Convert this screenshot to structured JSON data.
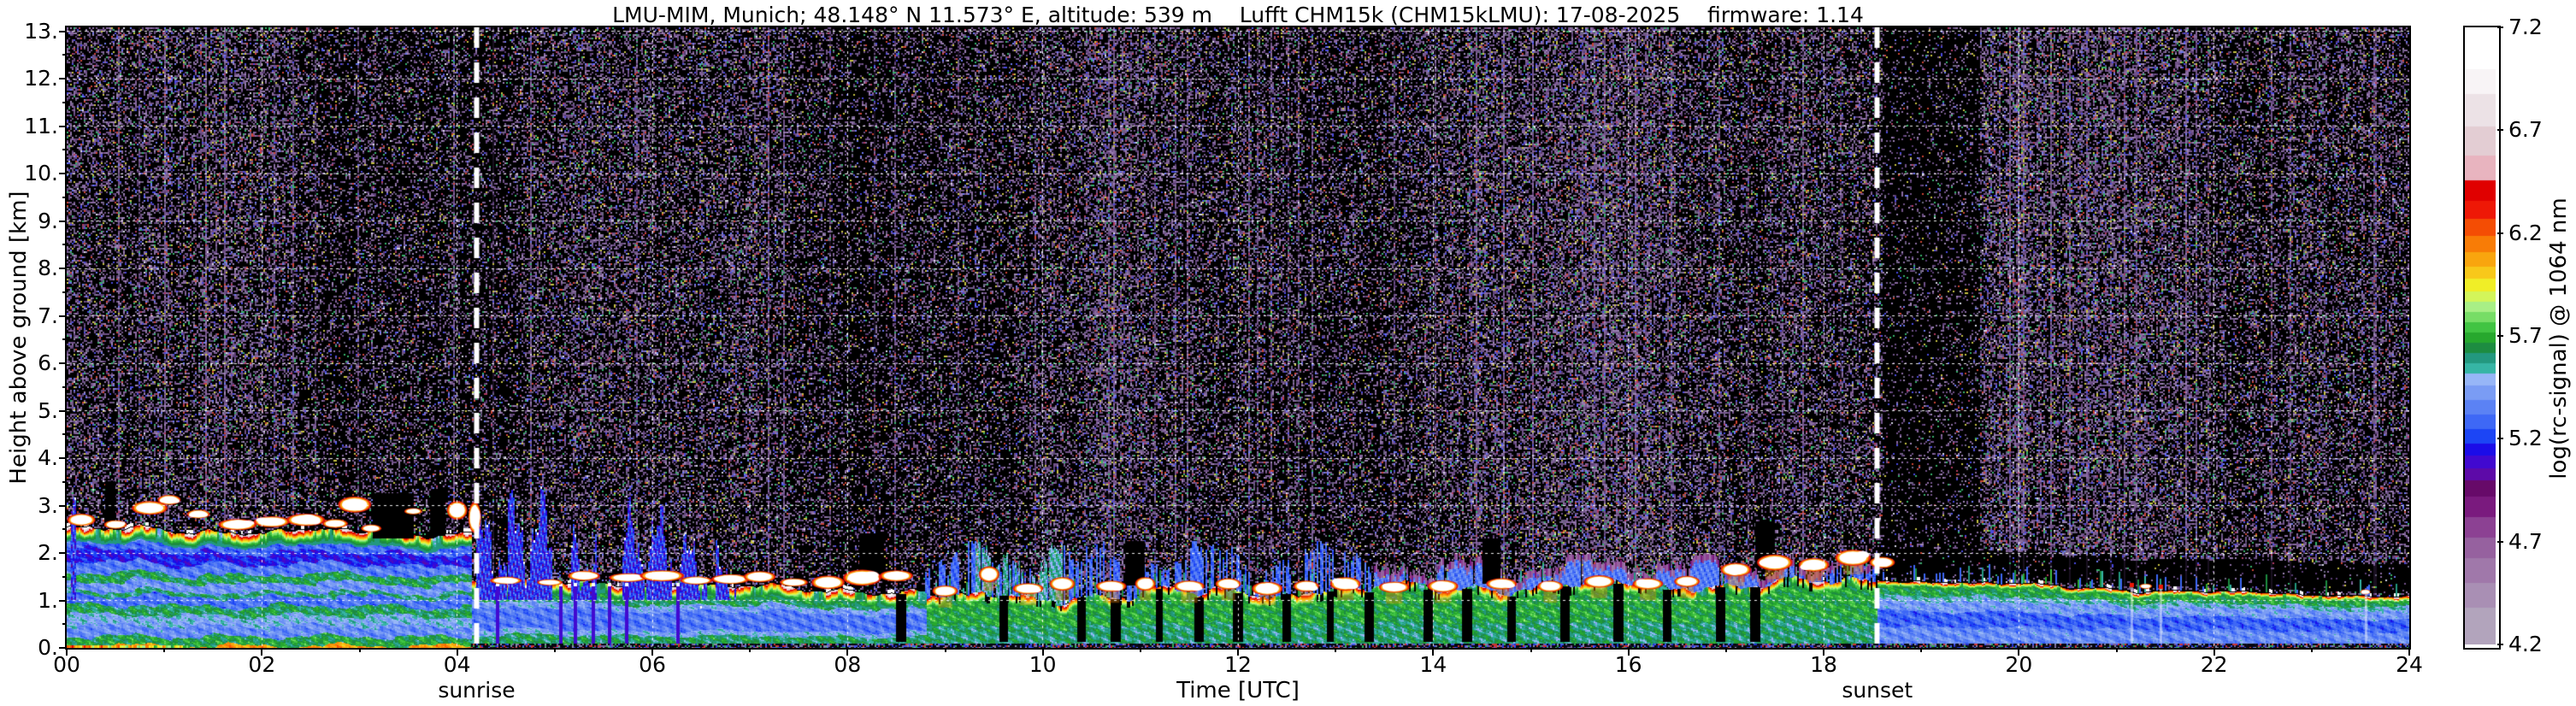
{
  "figure": {
    "title": "LMU-MIM, Munich; 48.148° N 11.573° E, altitude: 539 m    Lufft CHM15k (CHM15kLMU): 17-08-2025    firmware: 1.14",
    "xlabel": "Time [UTC]",
    "ylabel": "Height above ground [km]",
    "colorbar_label": "log(rc-signal) @ 1064 nm"
  },
  "axes": {
    "x": {
      "min": 0,
      "max": 24,
      "minor_step": 1,
      "ticks": [
        {
          "v": 0,
          "label": "00"
        },
        {
          "v": 2,
          "label": "02"
        },
        {
          "v": 4,
          "label": "04"
        },
        {
          "v": 6,
          "label": "06"
        },
        {
          "v": 8,
          "label": "08"
        },
        {
          "v": 10,
          "label": "10"
        },
        {
          "v": 12,
          "label": "12"
        },
        {
          "v": 14,
          "label": "14"
        },
        {
          "v": 16,
          "label": "16"
        },
        {
          "v": 18,
          "label": "18"
        },
        {
          "v": 20,
          "label": "20"
        },
        {
          "v": 22,
          "label": "22"
        },
        {
          "v": 24,
          "label": "24"
        }
      ]
    },
    "y": {
      "min": 0,
      "max": 13.08,
      "minor_step": 0.5,
      "ticks": [
        {
          "v": 0,
          "label": "0."
        },
        {
          "v": 1,
          "label": "1."
        },
        {
          "v": 2,
          "label": "2."
        },
        {
          "v": 3,
          "label": "3."
        },
        {
          "v": 4,
          "label": "4."
        },
        {
          "v": 5,
          "label": "5."
        },
        {
          "v": 6,
          "label": "6."
        },
        {
          "v": 7,
          "label": "7."
        },
        {
          "v": 8,
          "label": "8."
        },
        {
          "v": 9,
          "label": "9."
        },
        {
          "v": 10,
          "label": "10."
        },
        {
          "v": 11,
          "label": "11."
        },
        {
          "v": 12,
          "label": "12."
        },
        {
          "v": 13,
          "label": "13."
        }
      ]
    }
  },
  "colorbar": {
    "min": 4.2,
    "max": 7.2,
    "ticks": [
      {
        "v": 7.2,
        "label": "7.2"
      },
      {
        "v": 6.7,
        "label": "6.7"
      },
      {
        "v": 6.2,
        "label": "6.2"
      },
      {
        "v": 5.7,
        "label": "5.7"
      },
      {
        "v": 5.2,
        "label": "5.2"
      },
      {
        "v": 4.7,
        "label": "4.7"
      },
      {
        "v": 4.2,
        "label": "4.2"
      }
    ]
  },
  "annotations": {
    "sunrise": {
      "label": "sunrise",
      "t": 4.2
    },
    "sunset": {
      "label": "sunset",
      "t": 18.55
    }
  },
  "chart_data": {
    "type": "heatmap",
    "title": "LMU-MIM, Munich; 48.148° N 11.573° E, altitude: 539 m  Lufft CHM15k (CHM15kLMU): 17-08-2025  firmware: 1.14",
    "xlabel": "Time [UTC]",
    "ylabel": "Height above ground [km]",
    "value_label": "log(rc-signal) @ 1064 nm",
    "x_range_hours": [
      0,
      24
    ],
    "y_range_km": [
      0,
      13.08
    ],
    "value_range": [
      4.2,
      7.2
    ],
    "grid": {
      "color": "#ffffff",
      "style": "dashed",
      "x_step_h": 2,
      "y_step_km": 1
    },
    "sunrise_t": 4.2,
    "sunset_t": 18.55,
    "colormap": [
      [
        4.2,
        "#b2a4bc"
      ],
      [
        4.38,
        "#a98fb4"
      ],
      [
        4.5,
        "#a078aa"
      ],
      [
        4.62,
        "#96619f"
      ],
      [
        4.72,
        "#8c4193"
      ],
      [
        4.82,
        "#7a1a7e"
      ],
      [
        4.92,
        "#670a69"
      ],
      [
        5.0,
        "#5d0aa8"
      ],
      [
        5.06,
        "#4109d0"
      ],
      [
        5.12,
        "#1b0ce8"
      ],
      [
        5.18,
        "#1c45f5"
      ],
      [
        5.25,
        "#3e68f6"
      ],
      [
        5.32,
        "#5b82f4"
      ],
      [
        5.39,
        "#7a9cf4"
      ],
      [
        5.46,
        "#97b6f7"
      ],
      [
        5.52,
        "#36b5a5"
      ],
      [
        5.57,
        "#23987f"
      ],
      [
        5.62,
        "#1d8c41"
      ],
      [
        5.67,
        "#27a82e"
      ],
      [
        5.72,
        "#41c443"
      ],
      [
        5.77,
        "#77dd66"
      ],
      [
        5.82,
        "#a8ef86"
      ],
      [
        5.87,
        "#d3f55a"
      ],
      [
        5.92,
        "#f0ee27"
      ],
      [
        5.98,
        "#f8c81a"
      ],
      [
        6.04,
        "#f9a50e"
      ],
      [
        6.11,
        "#f87c06"
      ],
      [
        6.19,
        "#f44d04"
      ],
      [
        6.27,
        "#ee1806"
      ],
      [
        6.36,
        "#e00000"
      ],
      [
        6.46,
        "#e8b4bf"
      ],
      [
        6.58,
        "#e3cdd3"
      ],
      [
        6.72,
        "#ece2e6"
      ],
      [
        6.88,
        "#f8f4f6"
      ],
      [
        7.0,
        "#ffffff"
      ]
    ],
    "phases": [
      {
        "t0": 0,
        "t1": 4.15,
        "profile": "night1",
        "top0": 2.5,
        "top1": 2.42,
        "wig": 1.0,
        "cap": "strong",
        "spikes": 0
      },
      {
        "t0": 4.15,
        "t1": 8.8,
        "profile": "morning",
        "top0": 1.42,
        "top1": 1.18,
        "wig": 1.0,
        "cap": "strong",
        "spikes": 0
      },
      {
        "t0": 8.8,
        "t1": 13.4,
        "profile": "day",
        "top0": 1.05,
        "top1": 1.25,
        "wig": 1.8,
        "cap": "medium",
        "spikes": 1,
        "capgaps": 1
      },
      {
        "t0": 13.4,
        "t1": 16.8,
        "profile": "day",
        "top0": 1.28,
        "top1": 1.35,
        "wig": 1.6,
        "cap": "medium",
        "spikes": 1,
        "capgaps": 1
      },
      {
        "t0": 16.8,
        "t1": 18.55,
        "profile": "day",
        "top0": 1.35,
        "top1": 1.42,
        "wig": 1.4,
        "cap": "strong",
        "spikes": 1,
        "capgaps": 1
      },
      {
        "t0": 18.55,
        "t1": 21.5,
        "profile": "night2",
        "top0": 1.45,
        "top1": 1.2,
        "wig": 0.6,
        "cap": "night",
        "spikes": 0.8
      },
      {
        "t0": 21.5,
        "t1": 24.01,
        "profile": "night2",
        "top0": 1.2,
        "top1": 1.08,
        "wig": 0.4,
        "cap": "night",
        "spikes": 0.5
      }
    ],
    "profiles": {
      "night1": [
        [
          0,
          0.02,
          6.1
        ],
        [
          0.02,
          0.1,
          5.66
        ],
        [
          0.1,
          0.19,
          5.38
        ],
        [
          0.19,
          0.28,
          5.48
        ],
        [
          0.28,
          0.36,
          5.63
        ],
        [
          0.36,
          0.44,
          5.32
        ],
        [
          0.44,
          0.48,
          5.6
        ],
        [
          0.48,
          0.56,
          5.4
        ],
        [
          0.56,
          0.63,
          5.64
        ],
        [
          0.63,
          0.72,
          5.34
        ],
        [
          0.72,
          0.82,
          5.16
        ],
        [
          0.82,
          0.9,
          5.3
        ],
        [
          0.9,
          1,
          5.42
        ]
      ],
      "morning": [
        [
          0,
          0.03,
          6.0
        ],
        [
          0.03,
          0.2,
          5.62
        ],
        [
          0.2,
          0.28,
          5.46
        ],
        [
          0.28,
          0.6,
          5.33
        ],
        [
          0.6,
          0.7,
          5.44
        ],
        [
          0.7,
          0.84,
          5.62
        ],
        [
          0.84,
          1,
          5.5
        ]
      ],
      "day": [
        [
          0,
          0.05,
          5.5
        ],
        [
          0.05,
          0.42,
          5.6
        ],
        [
          0.42,
          0.88,
          5.68
        ],
        [
          0.88,
          1,
          5.58
        ]
      ],
      "night2": [
        [
          0,
          0.06,
          5.4
        ],
        [
          0.06,
          0.32,
          5.38
        ],
        [
          0.32,
          0.56,
          5.28
        ],
        [
          0.56,
          0.72,
          5.42
        ],
        [
          0.72,
          0.8,
          5.52
        ],
        [
          0.8,
          0.97,
          5.66
        ],
        [
          0.97,
          1,
          5.7
        ]
      ]
    },
    "clouds": [
      [
        0.15,
        2.7,
        0.22,
        0.2
      ],
      [
        0.5,
        2.6,
        0.18,
        0.14
      ],
      [
        0.85,
        2.95,
        0.28,
        0.22
      ],
      [
        1.05,
        3.12,
        0.18,
        0.16
      ],
      [
        1.35,
        2.82,
        0.18,
        0.14
      ],
      [
        1.75,
        2.6,
        0.3,
        0.18
      ],
      [
        2.1,
        2.66,
        0.28,
        0.18
      ],
      [
        2.45,
        2.7,
        0.3,
        0.2
      ],
      [
        2.75,
        2.62,
        0.2,
        0.14
      ],
      [
        2.95,
        3.02,
        0.26,
        0.26
      ],
      [
        3.12,
        2.52,
        0.16,
        0.12
      ],
      [
        3.55,
        2.88,
        0.14,
        0.1
      ],
      [
        4.0,
        2.9,
        0.16,
        0.3
      ],
      [
        4.18,
        2.75,
        0.1,
        0.5
      ],
      [
        4.5,
        1.42,
        0.25,
        0.12
      ],
      [
        4.95,
        1.38,
        0.2,
        0.1
      ],
      [
        5.3,
        1.52,
        0.25,
        0.16
      ],
      [
        5.75,
        1.48,
        0.3,
        0.14
      ],
      [
        6.1,
        1.52,
        0.35,
        0.18
      ],
      [
        6.45,
        1.42,
        0.25,
        0.13
      ],
      [
        6.8,
        1.45,
        0.3,
        0.16
      ],
      [
        7.1,
        1.5,
        0.25,
        0.18
      ],
      [
        7.45,
        1.38,
        0.22,
        0.13
      ],
      [
        7.8,
        1.38,
        0.26,
        0.22
      ],
      [
        8.15,
        1.48,
        0.3,
        0.26
      ],
      [
        8.5,
        1.52,
        0.26,
        0.18
      ],
      [
        9.0,
        1.2,
        0.2,
        0.18
      ],
      [
        9.45,
        1.55,
        0.16,
        0.26
      ],
      [
        9.85,
        1.25,
        0.24,
        0.18
      ],
      [
        10.2,
        1.35,
        0.2,
        0.22
      ],
      [
        10.7,
        1.3,
        0.24,
        0.18
      ],
      [
        11.05,
        1.35,
        0.16,
        0.22
      ],
      [
        11.5,
        1.3,
        0.24,
        0.18
      ],
      [
        11.9,
        1.35,
        0.2,
        0.18
      ],
      [
        12.3,
        1.25,
        0.24,
        0.22
      ],
      [
        12.7,
        1.3,
        0.2,
        0.18
      ],
      [
        13.1,
        1.35,
        0.24,
        0.22
      ],
      [
        13.6,
        1.28,
        0.24,
        0.18
      ],
      [
        14.1,
        1.3,
        0.24,
        0.2
      ],
      [
        14.7,
        1.35,
        0.24,
        0.18
      ],
      [
        15.2,
        1.3,
        0.2,
        0.18
      ],
      [
        15.7,
        1.4,
        0.24,
        0.2
      ],
      [
        16.2,
        1.35,
        0.24,
        0.18
      ],
      [
        16.6,
        1.4,
        0.2,
        0.18
      ],
      [
        17.1,
        1.65,
        0.24,
        0.22
      ],
      [
        17.5,
        1.8,
        0.28,
        0.26
      ],
      [
        17.9,
        1.75,
        0.24,
        0.22
      ],
      [
        18.3,
        1.9,
        0.28,
        0.26
      ],
      [
        18.6,
        1.8,
        0.2,
        0.18
      ],
      [
        21.3,
        1.3,
        0.1,
        0.08
      ],
      [
        23.55,
        1.18,
        0.08,
        0.08
      ]
    ],
    "upper_layers": [
      [
        8.8,
        13.4,
        2.25,
        5.3,
        0.5,
        0
      ],
      [
        9.3,
        10.2,
        2.5,
        5.55,
        0.75,
        0
      ],
      [
        13.4,
        17.7,
        2.0,
        5.34,
        0.95,
        1
      ],
      [
        17.7,
        18.55,
        1.9,
        5.3,
        0.65,
        1
      ]
    ],
    "remnant_columns": [
      [
        0.07,
        3.25,
        0.05
      ],
      [
        4.35,
        2.6,
        0.3
      ],
      [
        4.75,
        2.95,
        0.45
      ],
      [
        5.3,
        2.3,
        0.25
      ],
      [
        5.95,
        2.65,
        0.5
      ],
      [
        6.4,
        2.2,
        0.3
      ],
      [
        6.75,
        1.9,
        0.2
      ]
    ],
    "gaps_up": [
      [
        0.45,
        0.1,
        2.55
      ],
      [
        3.35,
        0.42,
        2.3
      ],
      [
        3.8,
        0.15,
        2.35
      ],
      [
        8.25,
        0.25,
        1.45
      ],
      [
        10.95,
        0.2,
        1.3
      ],
      [
        14.6,
        0.18,
        1.35
      ],
      [
        17.4,
        0.2,
        1.7
      ]
    ],
    "gaps_down": [
      [
        8.55,
        0.1
      ],
      [
        9.6,
        0.08
      ],
      [
        10.4,
        0.08
      ],
      [
        10.75,
        0.1
      ],
      [
        11.2,
        0.07
      ],
      [
        11.6,
        0.09
      ],
      [
        12.0,
        0.1
      ],
      [
        12.5,
        0.08
      ],
      [
        12.95,
        0.07
      ],
      [
        13.35,
        0.09
      ],
      [
        13.95,
        0.09
      ],
      [
        14.35,
        0.1
      ],
      [
        14.8,
        0.08
      ],
      [
        15.35,
        0.09
      ],
      [
        15.9,
        0.1
      ],
      [
        16.4,
        0.08
      ],
      [
        16.95,
        0.09
      ],
      [
        17.3,
        0.1
      ]
    ],
    "dark_streaks": [
      4.4,
      5.05,
      5.2,
      5.38,
      5.55,
      5.72,
      6.25
    ],
    "night_streaks": [
      [
        21.15,
        1.28
      ],
      [
        21.45,
        1.25
      ],
      [
        23.55,
        1.15
      ]
    ],
    "noise": {
      "base_density": 0.5,
      "palette": [
        [
          "#715389",
          0.3
        ],
        [
          "#8a6ba2",
          0.18
        ],
        [
          "#5a3d75",
          0.12
        ],
        [
          "#9d85b5",
          0.08
        ],
        [
          "#6b6680",
          0.08
        ],
        [
          "#4a4ae0",
          0.05
        ],
        [
          "#6d79f2",
          0.04
        ],
        [
          "#37b06a",
          0.05
        ],
        [
          "#c6c243",
          0.04
        ],
        [
          "#cc4433",
          0.03
        ],
        [
          "#b03a60",
          0.02
        ],
        [
          "#d8d8e8",
          0.01
        ]
      ]
    },
    "ground_strip": {
      "t_start": 4.15,
      "colors": [
        "#2233cc",
        "#4455ee",
        "#7b5e9a",
        "#33aa55",
        "#cc3333",
        "#8888aa",
        "#111122"
      ]
    }
  }
}
